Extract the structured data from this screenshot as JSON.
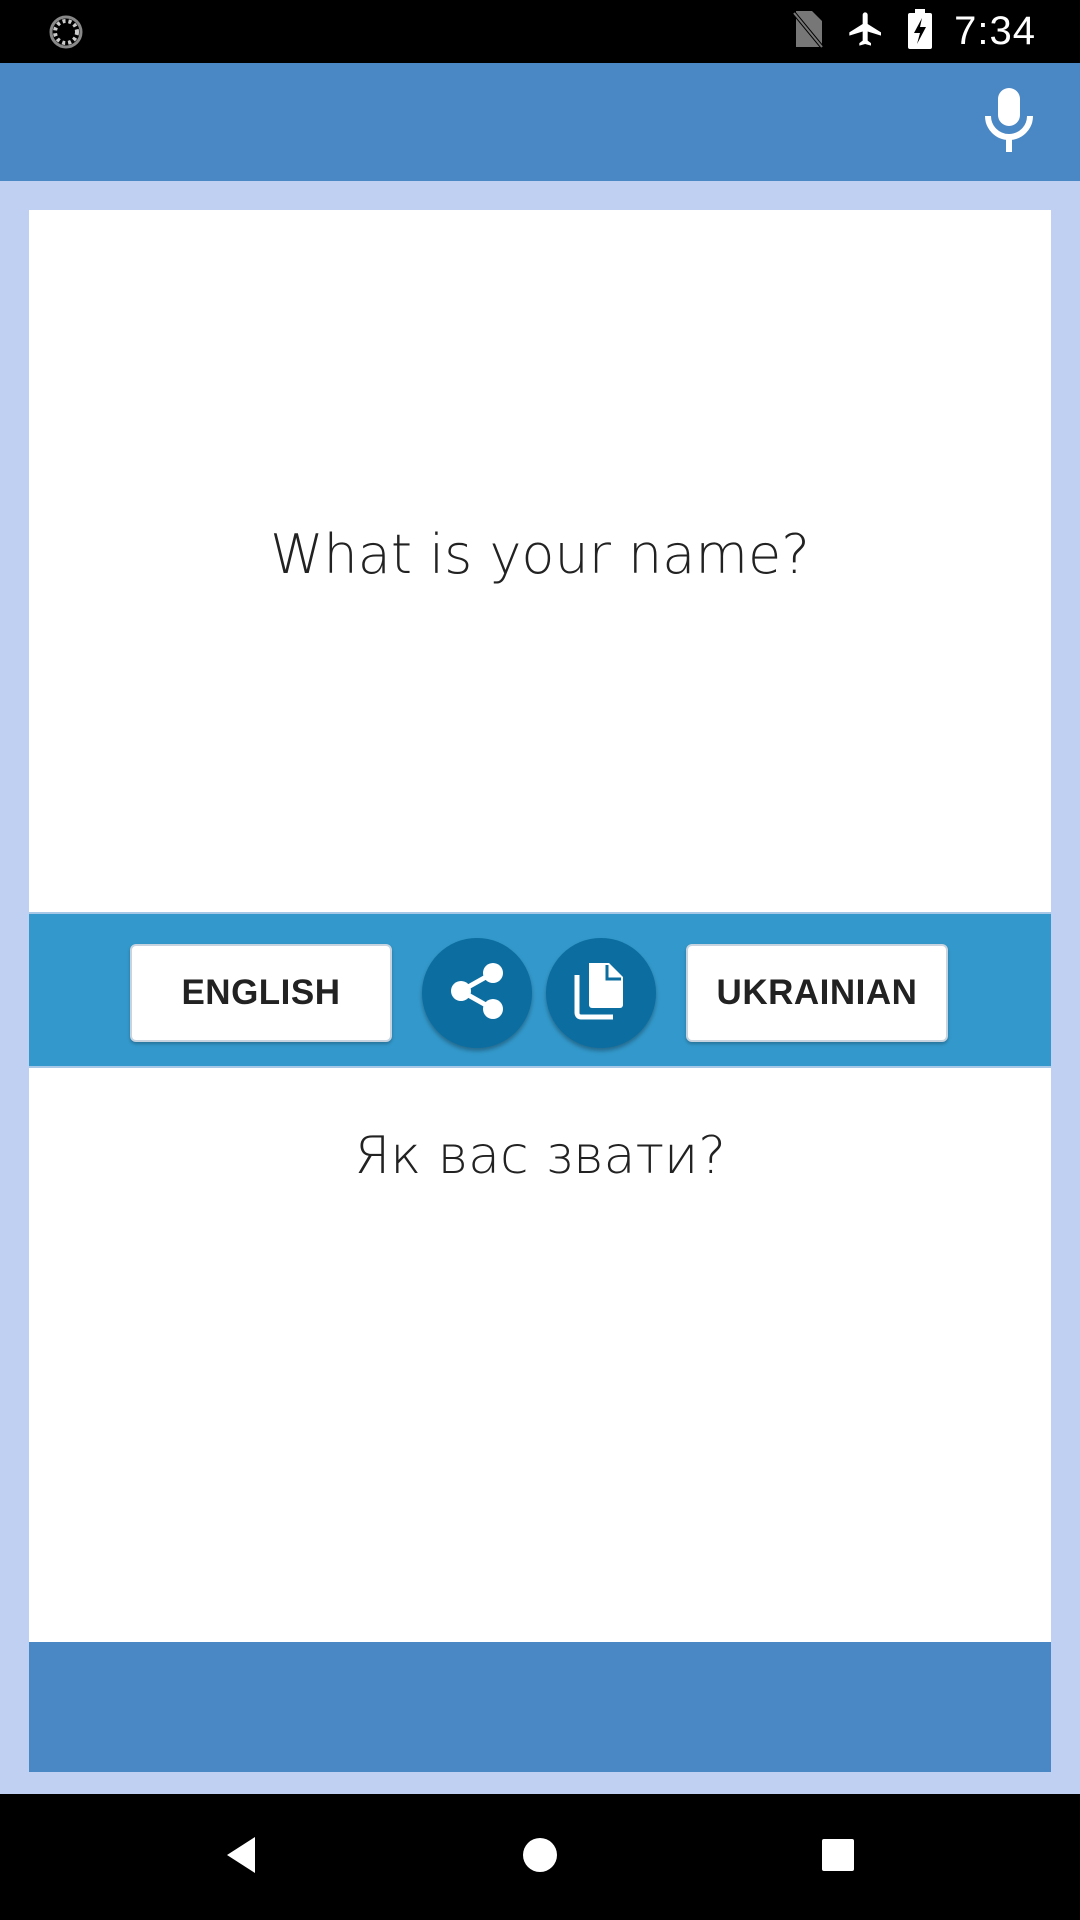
{
  "status_bar": {
    "time": "7:34",
    "icons": [
      "loading-icon",
      "no-sim-icon",
      "airplane-mode-icon",
      "battery-charging-icon"
    ]
  },
  "app_bar": {
    "mic_icon": "microphone-icon",
    "color": "#4a87c5"
  },
  "source": {
    "text": "What is your name?"
  },
  "toolbar": {
    "source_language": "ENGLISH",
    "target_language": "UKRAINIAN",
    "share_icon": "share-icon",
    "copy_icon": "copy-icon",
    "color": "#3399cc",
    "round_button_color": "#0b6da0"
  },
  "target": {
    "text": "Як вас звати?"
  },
  "nav_bar": {
    "icons": [
      "back-icon",
      "home-icon",
      "recents-icon"
    ]
  },
  "colors": {
    "background": "#bfd0f2",
    "panel": "#ffffff"
  }
}
